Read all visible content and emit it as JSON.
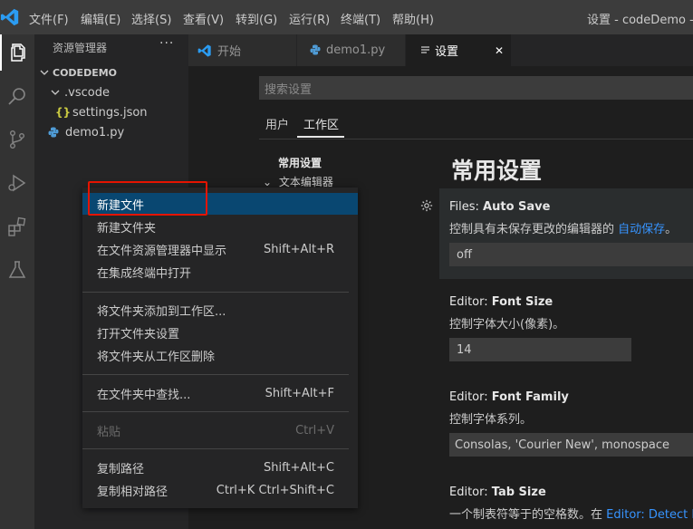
{
  "titlebar": {
    "logo_icon": "vscode-logo-icon",
    "menu": [
      "文件(F)",
      "编辑(E)",
      "选择(S)",
      "查看(V)",
      "转到(G)",
      "运行(R)",
      "终端(T)",
      "帮助(H)"
    ],
    "window_title": "设置 - codeDemo - Vis"
  },
  "activitybar": {
    "icons": [
      "explorer-icon",
      "search-icon",
      "source-control-icon",
      "run-debug-icon",
      "extensions-icon",
      "testing-icon"
    ]
  },
  "sidebar": {
    "title": "资源管理器",
    "more": "···",
    "tree": {
      "root": "CODEDEMO",
      "folder": ".vscode",
      "settings_file": "settings.json",
      "json_icon_glyph": "{}",
      "py_file": "demo1.py"
    }
  },
  "tabs": [
    {
      "label": "开始",
      "icon": "vscode-logo-icon"
    },
    {
      "label": "demo1.py",
      "icon": "python-icon"
    },
    {
      "label": "设置",
      "icon": "settings-file-icon",
      "close": "✕"
    }
  ],
  "settings": {
    "search_placeholder": "搜索设置",
    "scope_user": "用户",
    "scope_workspace": "工作区",
    "toc_common": "常用设置",
    "toc_editor": "文本编辑器",
    "section_title": "常用设置",
    "auto_save": {
      "prefix": "Files: ",
      "name": "Auto Save",
      "desc": "控制具有未保存更改的编辑器的 ",
      "link": "自动保存",
      "desc_end": "。",
      "value": "off"
    },
    "font_size": {
      "prefix": "Editor: ",
      "name": "Font Size",
      "desc": "控制字体大小(像素)。",
      "value": "14"
    },
    "font_family": {
      "prefix": "Editor: ",
      "name": "Font Family",
      "desc": "控制字体系列。",
      "value": "Consolas, 'Courier New', monospace"
    },
    "tab_size": {
      "prefix": "Editor: ",
      "name": "Tab Size",
      "desc": "一个制表符等于的空格数。在 ",
      "link": "Editor: Detect Inc"
    }
  },
  "context_menu": {
    "items": [
      {
        "label": "新建文件",
        "key": "",
        "state": "selected"
      },
      {
        "label": "新建文件夹",
        "key": ""
      },
      {
        "label": "在文件资源管理器中显示",
        "key": "Shift+Alt+R"
      },
      {
        "label": "在集成终端中打开",
        "key": ""
      },
      {
        "label": "将文件夹添加到工作区...",
        "key": ""
      },
      {
        "label": "打开文件夹设置",
        "key": ""
      },
      {
        "label": "将文件夹从工作区删除",
        "key": ""
      },
      {
        "label": "在文件夹中查找...",
        "key": "Shift+Alt+F"
      },
      {
        "label": "粘贴",
        "key": "Ctrl+V",
        "state": "disabled"
      },
      {
        "label": "复制路径",
        "key": "Shift+Alt+C"
      },
      {
        "label": "复制相对路径",
        "key": "Ctrl+K Ctrl+Shift+C"
      }
    ]
  },
  "colors": {
    "accent": "#007acc",
    "selection": "#094771",
    "highlight_box": "#e51400",
    "link": "#3794ff"
  }
}
